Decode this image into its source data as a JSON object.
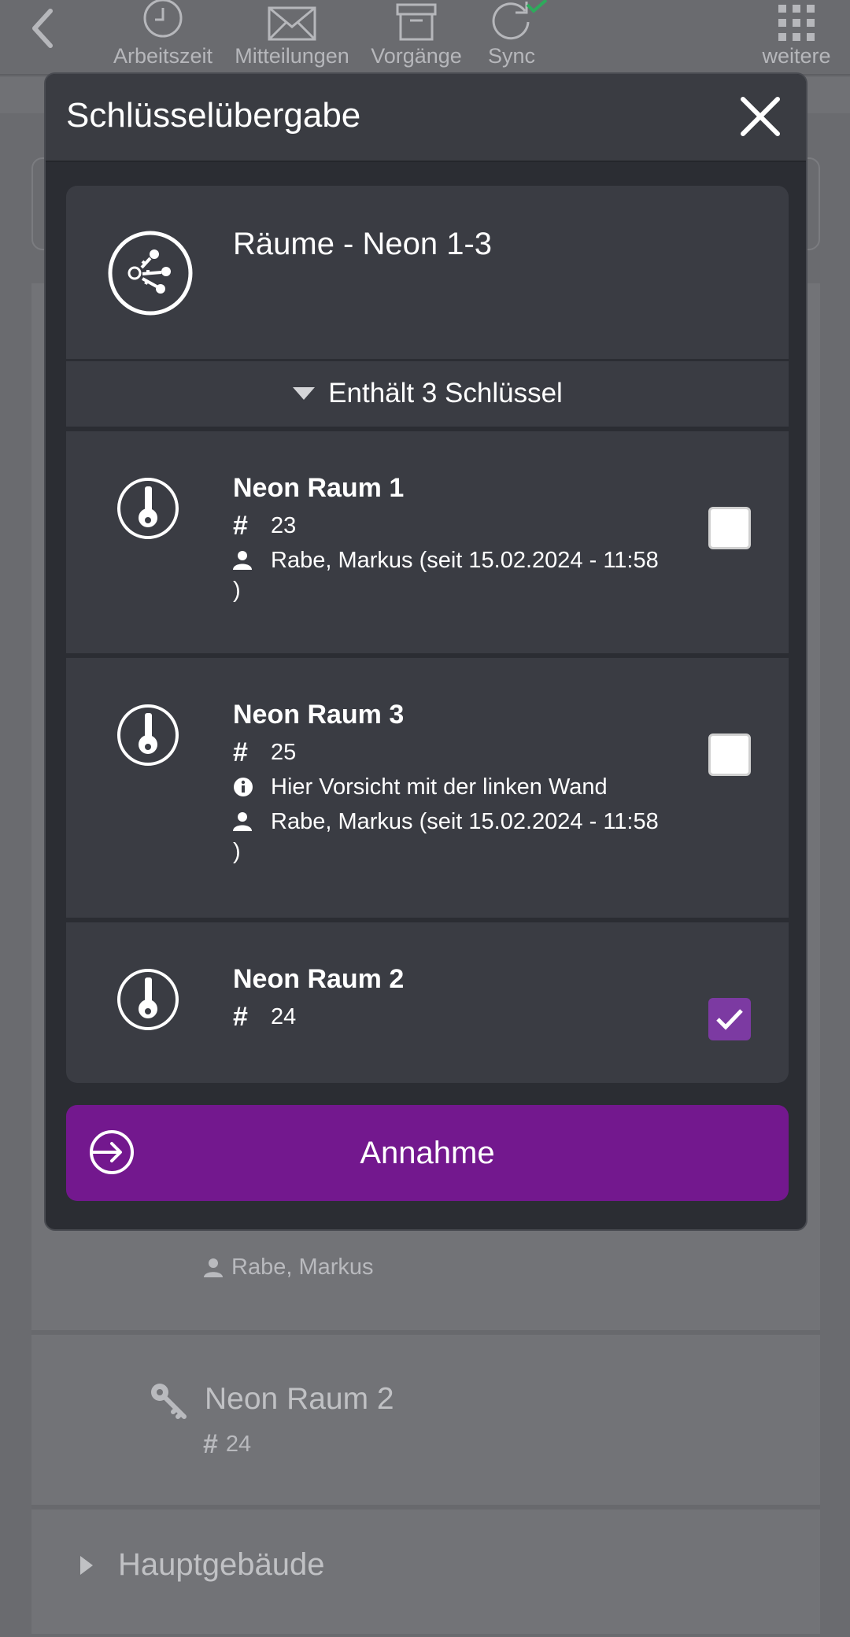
{
  "topbar": {
    "nav": [
      {
        "label": "Arbeitszeit",
        "icon": "clock-icon"
      },
      {
        "label": "Mitteilungen",
        "icon": "envelope-icon"
      },
      {
        "label": "Vorgänge",
        "icon": "archive-box-icon"
      },
      {
        "label": "Sync",
        "icon": "sync-icon",
        "status_icon": "check-icon"
      },
      {
        "label": "weitere",
        "icon": "grid-icon"
      }
    ]
  },
  "background": {
    "owner": "Rabe, Markus",
    "key_title": "Neon Raum 2",
    "key_number": "24",
    "group": "Hauptgebäude"
  },
  "modal": {
    "title": "Schlüsselübergabe",
    "group": {
      "title": "Räume - Neon 1-3",
      "count_label": "Enthält 3 Schlüssel"
    },
    "keys": [
      {
        "name": "Neon Raum 1",
        "number": "23",
        "holder": "Rabe, Markus (seit 15.02.2024 - 11:58",
        "holder_end": ")",
        "checked": false
      },
      {
        "name": "Neon Raum 3",
        "number": "25",
        "note": "Hier Vorsicht mit der linken Wand",
        "holder": "Rabe, Markus (seit 15.02.2024 - 11:58",
        "holder_end": ")",
        "checked": false
      },
      {
        "name": "Neon Raum 2",
        "number": "24",
        "checked": true
      }
    ],
    "action_label": "Annahme"
  },
  "colors": {
    "accent": "#73188e",
    "checkbox_checked": "#7c3aa2",
    "modal_bg": "#2b2d33",
    "panel_bg": "#3a3c43",
    "sync_ok": "#2eaa5c"
  }
}
